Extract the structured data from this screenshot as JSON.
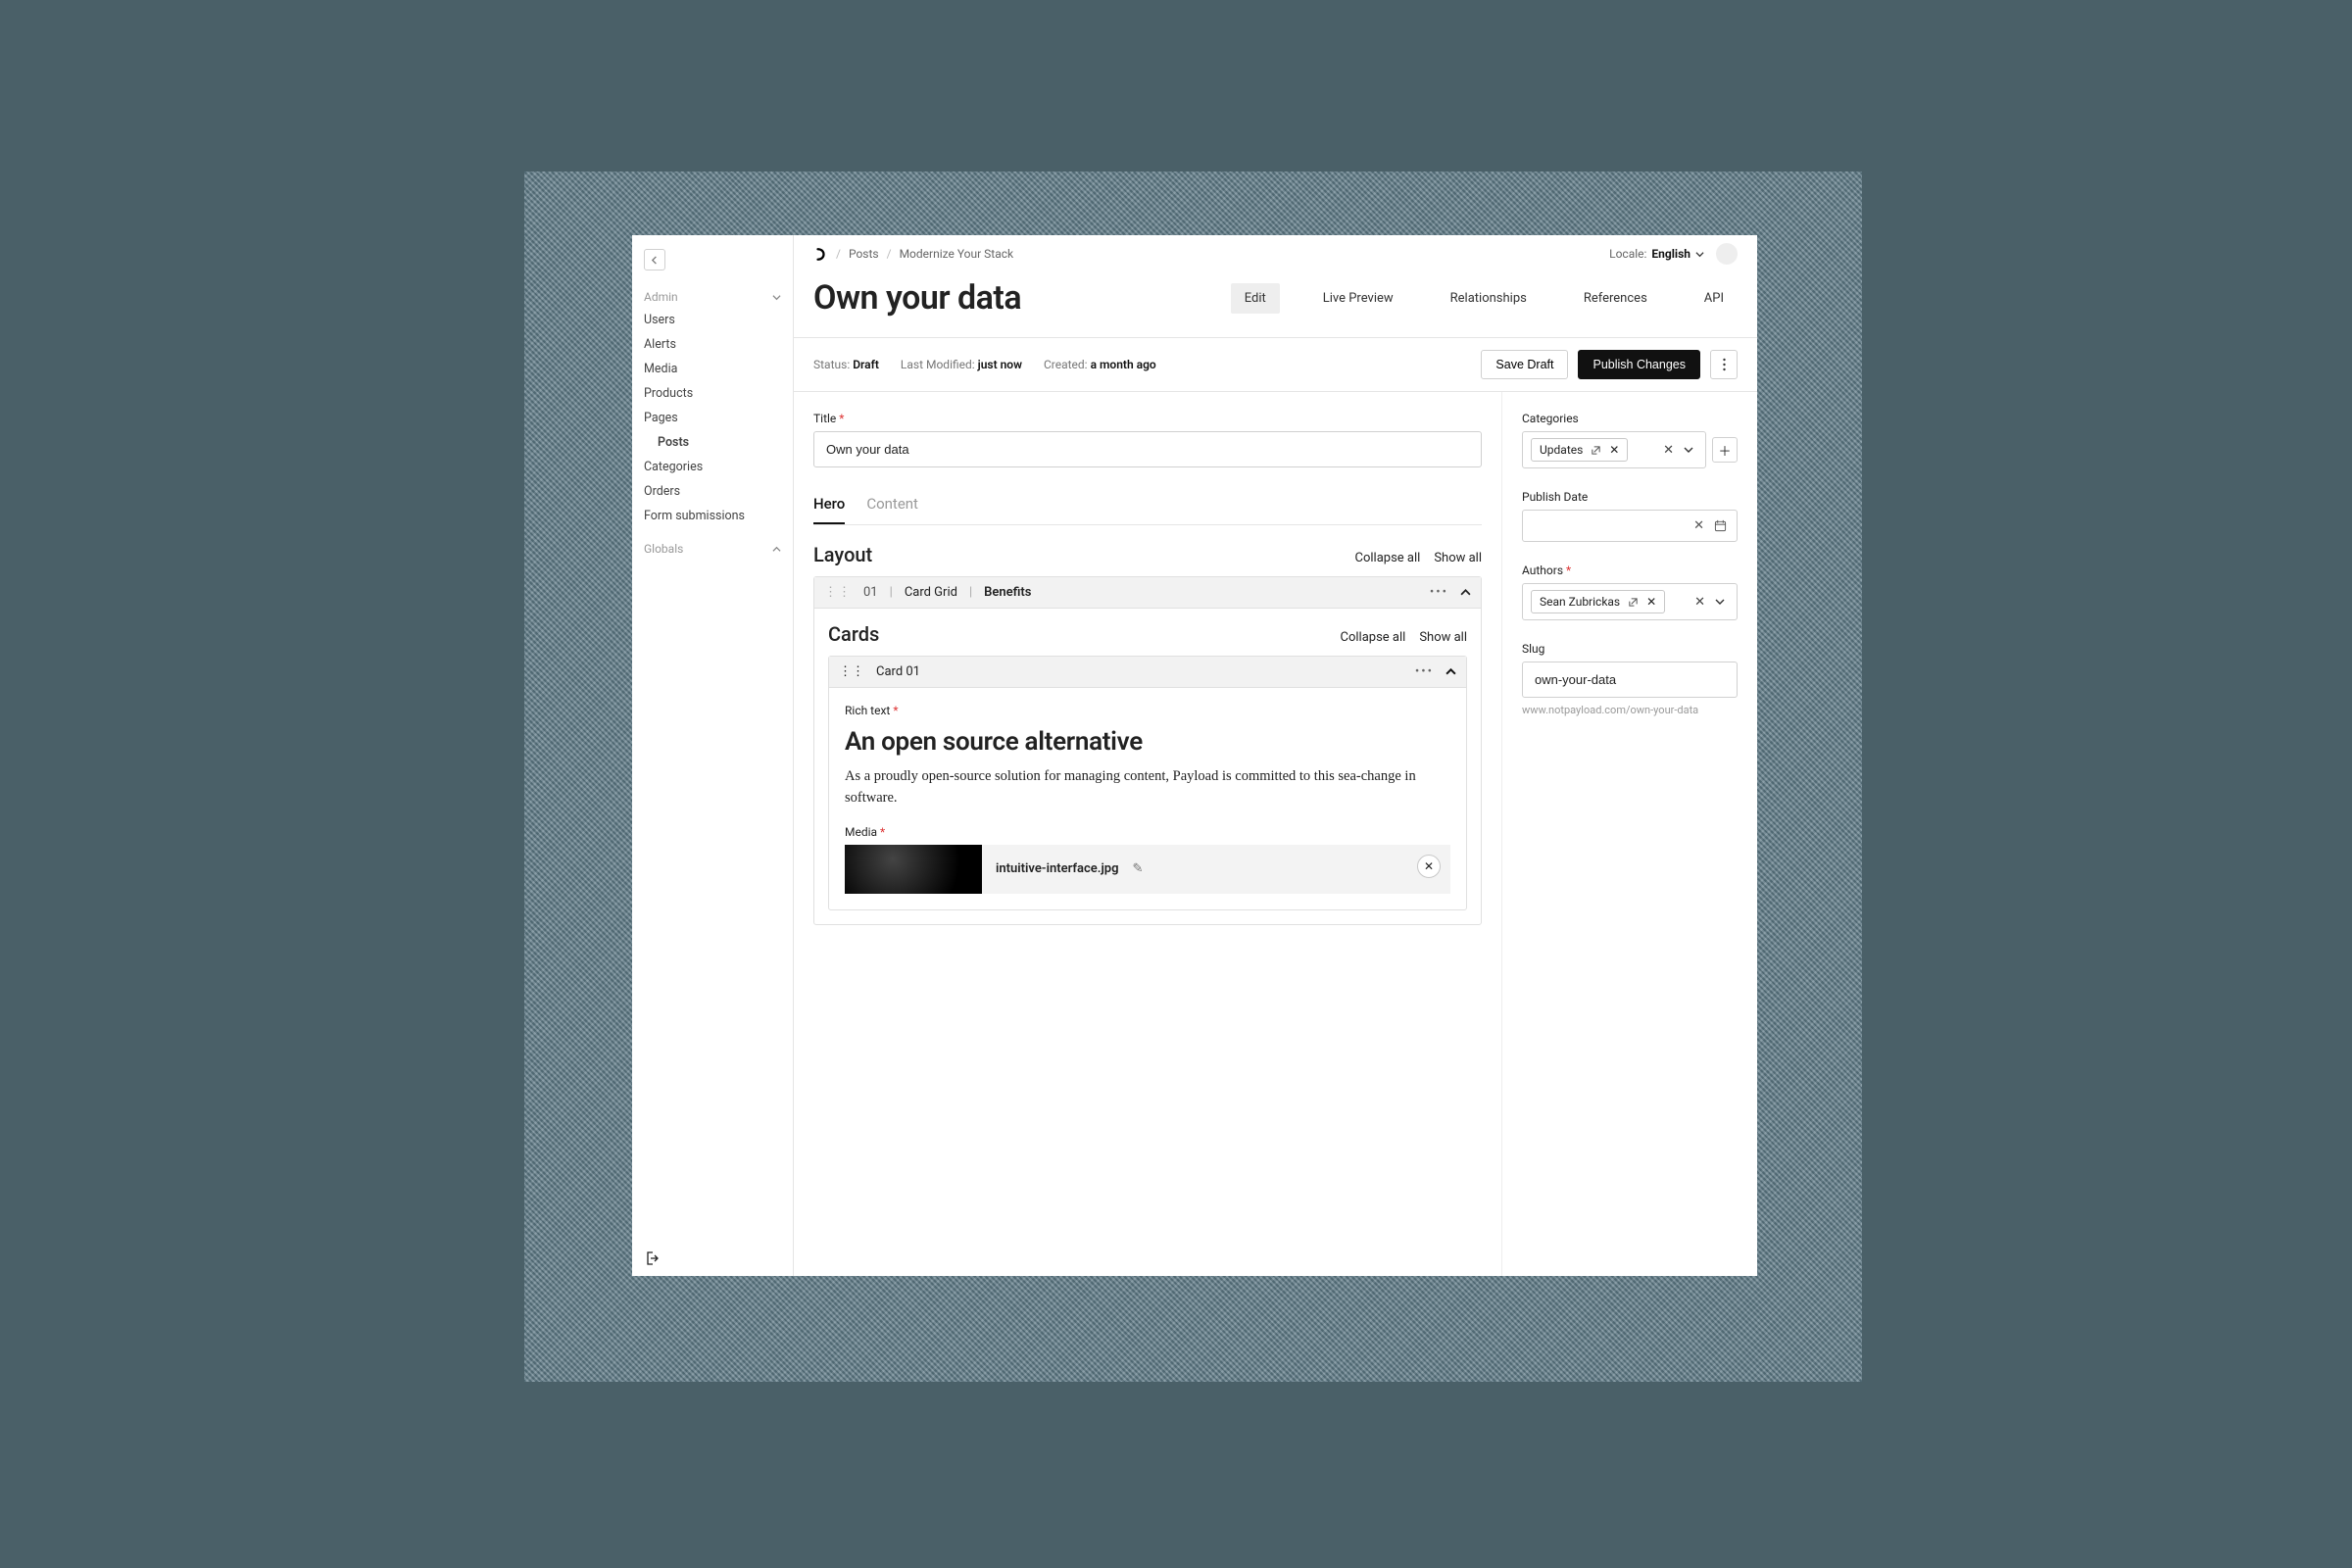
{
  "breadcrumb": {
    "collection": "Posts",
    "current": "Modernize Your Stack"
  },
  "locale": {
    "label": "Locale:",
    "value": "English"
  },
  "sidebar": {
    "groupAdmin": "Admin",
    "groupGlobals": "Globals",
    "items": [
      "Users",
      "Alerts",
      "Media",
      "Products",
      "Pages",
      "Posts",
      "Categories",
      "Orders",
      "Form submissions"
    ]
  },
  "page": {
    "title": "Own your data",
    "views": [
      "Edit",
      "Live Preview",
      "Relationships",
      "References",
      "API"
    ],
    "activeView": "Edit"
  },
  "status": {
    "statusLabel": "Status:",
    "statusValue": "Draft",
    "modifiedLabel": "Last Modified:",
    "modifiedValue": "just now",
    "createdLabel": "Created:",
    "createdValue": "a month ago",
    "saveDraft": "Save Draft",
    "publish": "Publish Changes"
  },
  "fields": {
    "titleLabel": "Title",
    "titleValue": "Own your data",
    "tabs": [
      "Hero",
      "Content"
    ],
    "activeTab": "Hero",
    "layoutHeading": "Layout",
    "collapseAll": "Collapse all",
    "showAll": "Show all",
    "block": {
      "num": "01",
      "type": "Card Grid",
      "name": "Benefits"
    },
    "cards": {
      "heading": "Cards",
      "card01": "Card 01",
      "richLabel": "Rich text",
      "richHeading": "An open source alternative",
      "richBody": "As a proudly open-source solution for managing content, Payload is committed to this sea-change in software.",
      "mediaLabel": "Media",
      "mediaFile": "intuitive-interface.jpg"
    }
  },
  "aside": {
    "categoriesLabel": "Categories",
    "categoryChip": "Updates",
    "publishDateLabel": "Publish Date",
    "authorsLabel": "Authors",
    "authorChip": "Sean Zubrickas",
    "slugLabel": "Slug",
    "slugValue": "own-your-data",
    "slugUrl": "www.notpayload.com/own-your-data"
  }
}
